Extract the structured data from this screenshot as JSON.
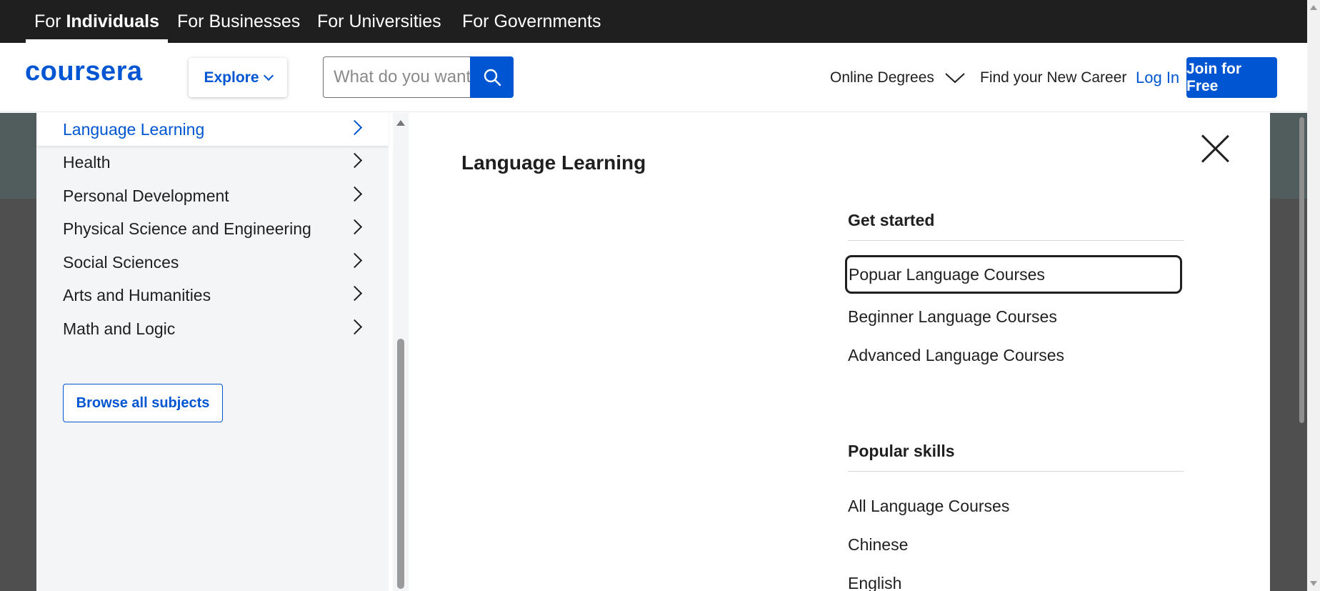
{
  "topbar": {
    "tabs": [
      {
        "prefix": "For ",
        "bold": "Individuals",
        "active": true
      },
      {
        "label": "For Businesses"
      },
      {
        "label": "For Universities"
      },
      {
        "label": "For Governments"
      }
    ]
  },
  "header": {
    "logo": "coursera",
    "explore_label": "Explore",
    "search_placeholder": "What do you want to learn?",
    "online_degrees": "Online Degrees",
    "career": "Find your New Career",
    "login": "Log In",
    "join": "Join for Free"
  },
  "sidebar": {
    "items": [
      {
        "label": "Language Learning",
        "active": true
      },
      {
        "label": "Health"
      },
      {
        "label": "Personal Development"
      },
      {
        "label": "Physical Science and Engineering"
      },
      {
        "label": "Social Sciences"
      },
      {
        "label": "Arts and Humanities"
      },
      {
        "label": "Math and Logic"
      }
    ],
    "browse_all": "Browse all subjects"
  },
  "content": {
    "title": "Language Learning",
    "get_started": {
      "heading": "Get started",
      "links": [
        "Popuar Language Courses",
        "Beginner Language Courses",
        "Advanced Language Courses"
      ]
    },
    "popular_skills": {
      "heading": "Popular skills",
      "links": [
        "All Language Courses",
        "Chinese",
        "English"
      ]
    }
  },
  "colors": {
    "brand": "#0056d2",
    "topbar_bg": "#1f1f1f",
    "sidebar_bg": "#f4f5f7",
    "backdrop": "#4f4f4f"
  }
}
